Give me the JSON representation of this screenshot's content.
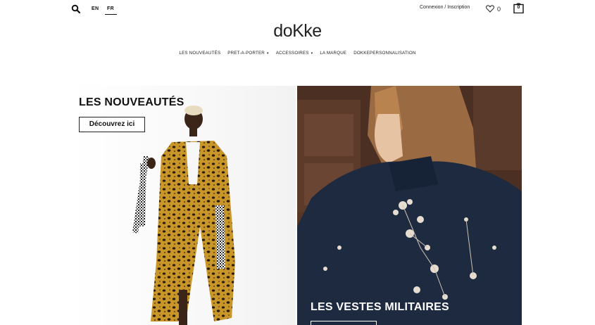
{
  "topbar": {
    "search_icon": "search-icon",
    "lang_en": "EN",
    "lang_fr": "FR",
    "login": "Connexion / Inscription",
    "wishlist_count": "0",
    "cart_count": "0"
  },
  "logo": "doKke",
  "nav": {
    "items": [
      {
        "label": "LES NOUVEAUTÉS",
        "dropdown": false
      },
      {
        "label": "PRET-A-PORTER",
        "dropdown": true
      },
      {
        "label": "ACCESSOIRES",
        "dropdown": true
      },
      {
        "label": "LA MARQUE",
        "dropdown": false
      },
      {
        "label": "DOKKEPERSONNALISATION",
        "dropdown": false
      }
    ],
    "caret": "▾"
  },
  "hero": {
    "left": {
      "title": "LES NOUVEAUTÉS",
      "button": "Découvrez ici"
    },
    "right": {
      "title": "LES VESTES MILITAIRES"
    }
  }
}
